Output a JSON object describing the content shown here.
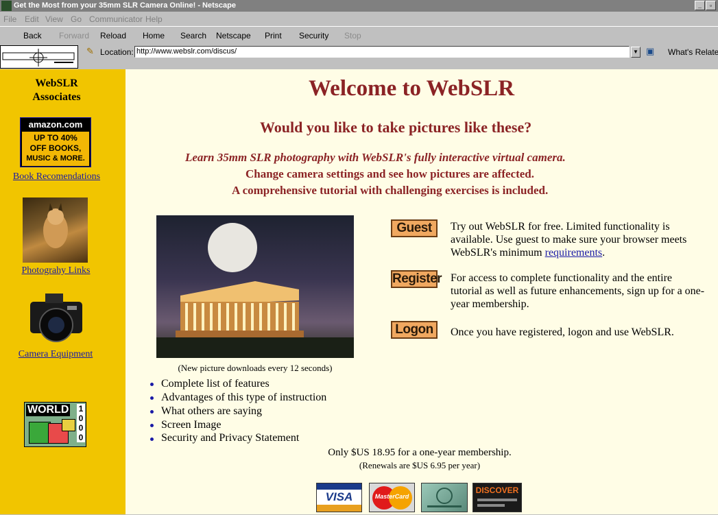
{
  "window": {
    "title": "Get the Most from your 35mm SLR Camera Online! - Netscape"
  },
  "menu": [
    "File",
    "Edit",
    "View",
    "Go",
    "Communicator",
    "Help"
  ],
  "toolbar": {
    "back": "Back",
    "forward": "Forward",
    "reload": "Reload",
    "home": "Home",
    "search": "Search",
    "netscape": "Netscape",
    "print": "Print",
    "security": "Security",
    "stop": "Stop"
  },
  "location": {
    "label": "Location:",
    "url": "http://www.webslr.com/discus/",
    "related": "What's Related"
  },
  "sidebar": {
    "title_line1": "WebSLR",
    "title_line2": "Associates",
    "amazon_logo": "amazon.com",
    "amazon_text1": "UP TO 40%",
    "amazon_text2": "OFF BOOKS,",
    "amazon_text3": "MUSIC & MORE.",
    "book_link": "Book Recomendations",
    "photo_link": "Photograhy Links",
    "camera_link": "Camera Equipment",
    "world_badge": "WORLD",
    "world_num": "1000"
  },
  "main": {
    "heading": "Welcome to WebSLR",
    "subheading": "Would you like to take pictures like these?",
    "tagline_italic": "Learn 35mm SLR photography with WebSLR's fully interactive virtual camera.",
    "tagline_2": "Change camera settings and see how pictures are affected.",
    "tagline_3": "A comprehensive tutorial with challenging exercises is included.",
    "photo_caption": "(New picture downloads every 12 seconds)",
    "guest_label": "Guest",
    "guest_desc_pre": "Try out WebSLR for free. Limited functionality is available. Use guest to make sure your browser meets WebSLR's minimum ",
    "guest_desc_link": "requirements",
    "guest_desc_post": ".",
    "register_label": "Register",
    "register_desc": "For access to complete functionality and the entire tutorial as well as future enhancements, sign up for a one-year membership.",
    "logon_label": "Logon",
    "logon_desc": "Once you have registered, logon and use WebSLR.",
    "features": [
      "Complete list of features",
      "Advantages of this type of instruction",
      "What others are saying",
      "Screen Image",
      "Security and Privacy Statement"
    ],
    "price": "Only $US 18.95 for a one-year membership.",
    "renewal": "(Renewals are $US 6.95 per year)",
    "cards": {
      "visa": "VISA",
      "mastercard": "MasterCard",
      "discover": "DISCOVER"
    }
  },
  "colors": {
    "sidebar_bg": "#f1c500",
    "main_bg": "#fffde6",
    "heading": "#8b2325",
    "link": "#1a1aa6",
    "button": "#f0a860"
  }
}
